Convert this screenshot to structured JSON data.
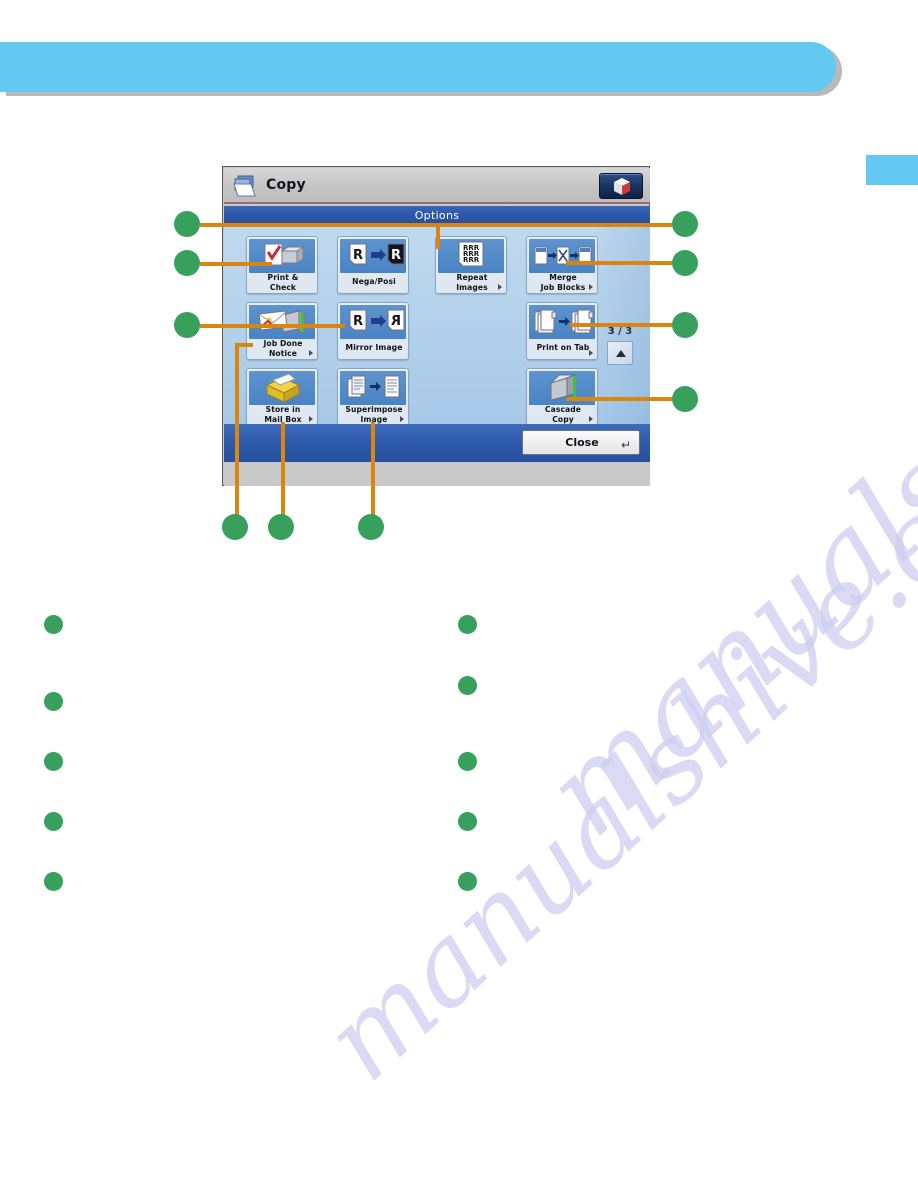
{
  "page": {
    "watermark": "manualshive.com",
    "banner_label": "",
    "side_tab_label": ""
  },
  "panel": {
    "title": "Copy",
    "title_icon": "documents-icon",
    "cube_button_icon": "3d-cube-icon",
    "options_bar_label": "Options",
    "pager": {
      "label": "3 / 3",
      "up_button_icon": "triangle-up-icon"
    },
    "close": {
      "label": "Close",
      "enter_glyph": "↵"
    },
    "buttons": [
      {
        "id": "print-and-check",
        "label_lines": [
          "Print &",
          "Check"
        ],
        "icon": "print-check-icon",
        "has_arrow": false,
        "col": 0,
        "row": 0
      },
      {
        "id": "nega-posi",
        "label_lines": [
          "Nega/Posi"
        ],
        "icon": "nega-posi-icon",
        "has_arrow": false,
        "col": 1,
        "row": 0
      },
      {
        "id": "repeat-images",
        "label_lines": [
          "Repeat",
          "Images"
        ],
        "icon": "repeat-images-icon",
        "has_arrow": true,
        "col": 2,
        "row": 0
      },
      {
        "id": "merge-job-blocks",
        "label_lines": [
          "Merge",
          "Job Blocks"
        ],
        "icon": "merge-job-blocks-icon",
        "has_arrow": true,
        "col": 3,
        "row": 0
      },
      {
        "id": "job-done-notice",
        "label_lines": [
          "Job Done",
          "Notice"
        ],
        "icon": "job-done-notice-icon",
        "has_arrow": true,
        "col": 0,
        "row": 1
      },
      {
        "id": "mirror-image",
        "label_lines": [
          "Mirror Image"
        ],
        "icon": "mirror-image-icon",
        "has_arrow": false,
        "col": 1,
        "row": 1
      },
      {
        "id": "print-on-tab",
        "label_lines": [
          "Print on Tab"
        ],
        "icon": "print-on-tab-icon",
        "has_arrow": true,
        "col": 3,
        "row": 1
      },
      {
        "id": "store-in-mail-box",
        "label_lines": [
          "Store in",
          "Mail Box"
        ],
        "icon": "store-mailbox-icon",
        "has_arrow": true,
        "col": 0,
        "row": 2
      },
      {
        "id": "superimpose-image",
        "label_lines": [
          "Superimpose",
          "Image"
        ],
        "icon": "superimpose-icon",
        "has_arrow": true,
        "col": 1,
        "row": 2
      },
      {
        "id": "cascade-copy",
        "label_lines": [
          "Cascade",
          "Copy"
        ],
        "icon": "cascade-copy-icon",
        "has_arrow": true,
        "col": 3,
        "row": 2
      }
    ]
  },
  "callouts": {
    "left": [
      {
        "target": "repeat-images-leader"
      },
      {
        "target": "print-and-check"
      },
      {
        "target": "mirror-image"
      }
    ],
    "right": [
      {
        "target": "options-bar"
      },
      {
        "target": "merge-job-blocks"
      },
      {
        "target": "print-on-tab"
      },
      {
        "target": "cascade-copy"
      }
    ],
    "bottom": [
      {
        "target": "job-done-notice"
      },
      {
        "target": "store-in-mail-box"
      },
      {
        "target": "superimpose-image"
      }
    ]
  },
  "legend": {
    "left_column": [
      {
        "text": ""
      },
      {
        "text": ""
      },
      {
        "text": ""
      },
      {
        "text": ""
      },
      {
        "text": ""
      }
    ],
    "right_column": [
      {
        "text": ""
      },
      {
        "text": ""
      },
      {
        "text": ""
      },
      {
        "text": ""
      },
      {
        "text": ""
      }
    ]
  },
  "colors": {
    "banner": "#63c9f2",
    "leader": "#d8860f",
    "bullet": "#36a05c",
    "panel_blue": "#27509f",
    "screen_blue": "#a7c9e8",
    "button_blue": "#4a83c4"
  }
}
